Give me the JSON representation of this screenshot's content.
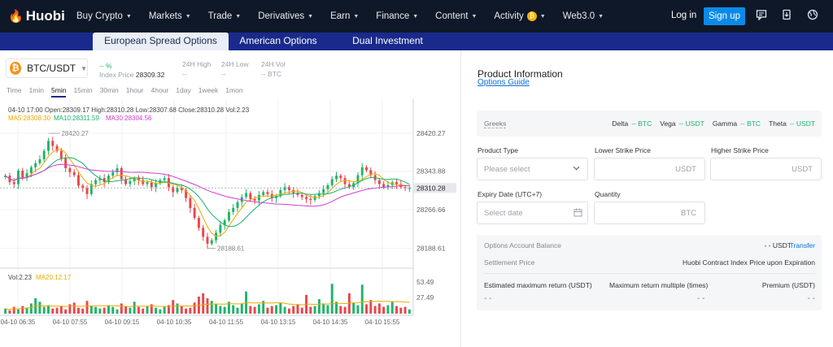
{
  "nav": {
    "logo_text": "Huobi",
    "items": [
      {
        "label": "Buy Crypto",
        "caret": true
      },
      {
        "label": "Markets",
        "caret": true
      },
      {
        "label": "Trade",
        "caret": true
      },
      {
        "label": "Derivatives",
        "caret": true
      },
      {
        "label": "Earn",
        "caret": true
      },
      {
        "label": "Finance",
        "caret": true
      },
      {
        "label": "Content",
        "caret": true
      },
      {
        "label": "Activity",
        "caret": true,
        "badge": "₿"
      },
      {
        "label": "Web3.0",
        "caret": true
      }
    ],
    "login": "Log in",
    "signup": "Sign up",
    "icons": [
      "message-icon",
      "download-icon",
      "globe-icon"
    ]
  },
  "tabs": {
    "items": [
      "European Spread Options",
      "American Options",
      "Dual Investment"
    ],
    "active": 0
  },
  "market": {
    "pair": "BTC/USDT",
    "change": "-- %",
    "index_price_label": "Index Price",
    "index_price": "28309.32",
    "high_label": "24H High",
    "high_value": "--",
    "low_label": "24H Low",
    "low_value": "--",
    "vol_label": "24H Vol",
    "vol_value": "-- BTC"
  },
  "intervals": {
    "items": [
      "Time",
      "1min",
      "5min",
      "15min",
      "30min",
      "1hour",
      "4hour",
      "1day",
      "1week",
      "1mon"
    ],
    "active": "5min"
  },
  "candle_info": {
    "ohlc": "04-10 17:00  Open:28309.17  High:28310.28  Low:28307.68  Close:28310.28  Vol:2.23",
    "ma5": "MA5:28308.30",
    "ma10": "MA10:28311.59",
    "ma30": "MA30:28304.56",
    "vol": "Vol:2.23",
    "vol_ma20": "MA20:12.17"
  },
  "chart_data": {
    "type": "candlestick",
    "price_ticks": [
      "28420.27",
      "28343.88",
      "28266.66",
      "28188.61"
    ],
    "current_price": "28310.28",
    "max_label": "28420.27",
    "min_label": "28188.61",
    "vol_ticks": [
      "53.49",
      "27.49"
    ],
    "time_ticks": [
      "04-10 06:35",
      "04-10 07:55",
      "04-10 09:15",
      "04-10 10:35",
      "04-10 11:55",
      "04-10 13:15",
      "04-10 14:35",
      "04-10 15:55"
    ],
    "ylim": [
      28170,
      28440
    ],
    "closes": [
      28335,
      28322,
      28318,
      28345,
      28330,
      28340,
      28352,
      28360,
      28368,
      28385,
      28405,
      28395,
      28385,
      28370,
      28350,
      28342,
      28336,
      28315,
      28310,
      28298,
      28318,
      28326,
      28330,
      28322,
      28335,
      28342,
      28350,
      28328,
      28318,
      28324,
      28330,
      28326,
      28318,
      28322,
      28312,
      28320,
      28326,
      28330,
      28312,
      28302,
      28310,
      28306,
      28290,
      28270,
      28250,
      28230,
      28212,
      28198,
      28205,
      28220,
      28236,
      28245,
      28262,
      28270,
      28282,
      28292,
      28300,
      28288,
      28285,
      28296,
      28302,
      28298,
      28290,
      28294,
      28306,
      28312,
      28306,
      28300,
      28296,
      28292,
      28288,
      28286,
      28294,
      28300,
      28308,
      28316,
      28328,
      28335,
      28330,
      28318,
      28312,
      28320,
      28336,
      28352,
      28346,
      28336,
      28326,
      28318,
      28312,
      28316,
      28322,
      28318,
      28312,
      28310,
      28310
    ],
    "volumes": [
      6,
      4,
      8,
      5,
      9,
      7,
      12,
      18,
      14,
      8,
      10,
      6,
      7,
      9,
      5,
      11,
      13,
      7,
      6,
      15,
      9,
      8,
      6,
      7,
      10,
      8,
      5,
      12,
      9,
      7,
      14,
      8,
      6,
      9,
      11,
      7,
      5,
      8,
      10,
      16,
      12,
      9,
      6,
      7,
      13,
      20,
      24,
      18,
      15,
      11,
      9,
      8,
      14,
      10,
      7,
      12,
      26,
      9,
      8,
      11,
      15,
      7,
      9,
      10,
      13,
      8,
      6,
      9,
      11,
      7,
      22,
      8,
      9,
      17,
      12,
      10,
      35,
      14,
      9,
      8,
      24,
      13,
      10,
      34,
      11,
      16,
      9,
      12,
      8,
      10,
      14,
      9,
      7,
      8,
      5
    ],
    "ma5_color": "#f0a800",
    "ma10_color": "#17b26a",
    "ma30_color": "#d43ad0",
    "up_color": "#1fb46a",
    "down_color": "#e8464b"
  },
  "product": {
    "title": "Product Information",
    "guide_link": "Options Guide",
    "greeks_label": "Greeks",
    "greeks": [
      {
        "name": "Delta",
        "value": "-- BTC"
      },
      {
        "name": "Vega",
        "value": "-- USDT"
      },
      {
        "name": "Gamma",
        "value": "-- BTC"
      },
      {
        "name": "Theta",
        "value": "-- USDT"
      }
    ],
    "product_type_label": "Product Type",
    "product_type_placeholder": "Please select",
    "lower_strike_label": "Lower Strike Price",
    "lower_strike_unit": "USDT",
    "higher_strike_label": "Higher Strike Price",
    "higher_strike_unit": "USDT",
    "expiry_label": "Expiry Date (UTC+7)",
    "expiry_placeholder": "Select date",
    "quantity_label": "Quantity",
    "quantity_unit": "BTC",
    "balance_label": "Options Account Balance",
    "balance_value": "- - USDT",
    "transfer_link": "Transfer",
    "settlement_label": "Settlement Price",
    "settlement_value": "Huobi Contract Index Price upon Expiration",
    "est_return_label": "Estimated maximum return (USDT)",
    "max_multiple_label": "Maximum return multiple (times)",
    "premium_label": "Premium (USDT)",
    "est_return_value": "- -",
    "max_multiple_value": "- -",
    "premium_value": "- -"
  }
}
